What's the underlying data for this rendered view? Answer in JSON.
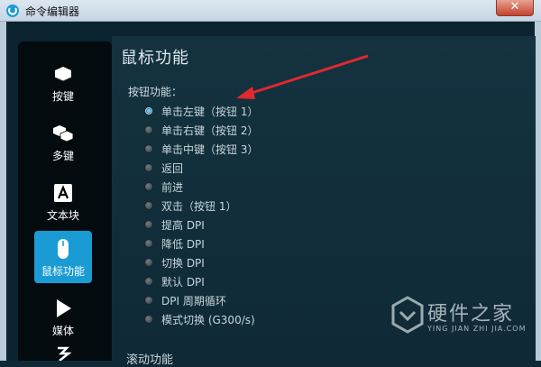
{
  "window": {
    "title": "命令编辑器",
    "close_label": "✕"
  },
  "sidebar": {
    "items": [
      {
        "label": "按键",
        "icon": "key-icon"
      },
      {
        "label": "多键",
        "icon": "multi-key-icon"
      },
      {
        "label": "文本块",
        "icon": "text-block-icon"
      },
      {
        "label": "鼠标功能",
        "icon": "mouse-icon",
        "active": true
      },
      {
        "label": "媒体",
        "icon": "media-play-icon"
      }
    ]
  },
  "main": {
    "title": "鼠标功能",
    "section_label": "按钮功能：",
    "options": [
      {
        "label": "单击左键（按钮 1）",
        "checked": true
      },
      {
        "label": "单击右键（按钮 2）",
        "checked": false
      },
      {
        "label": "单击中键（按钮 3）",
        "checked": false
      },
      {
        "label": "返回",
        "checked": false
      },
      {
        "label": "前进",
        "checked": false
      },
      {
        "label": "双击（按钮 1）",
        "checked": false
      },
      {
        "label": "提高 DPI",
        "checked": false
      },
      {
        "label": "降低 DPI",
        "checked": false
      },
      {
        "label": "切换 DPI",
        "checked": false
      },
      {
        "label": "默认 DPI",
        "checked": false
      },
      {
        "label": "DPI 周期循环",
        "checked": false
      },
      {
        "label": "模式切换 (G300/s)",
        "checked": false
      }
    ],
    "scroll_section_title": "滚动功能"
  },
  "watermark": {
    "text": "硬件之家",
    "subtext": "YING JIAN ZHI JIA.COM"
  },
  "colors": {
    "accent": "#1b9bd3",
    "annotation_arrow": "#e0282e"
  }
}
